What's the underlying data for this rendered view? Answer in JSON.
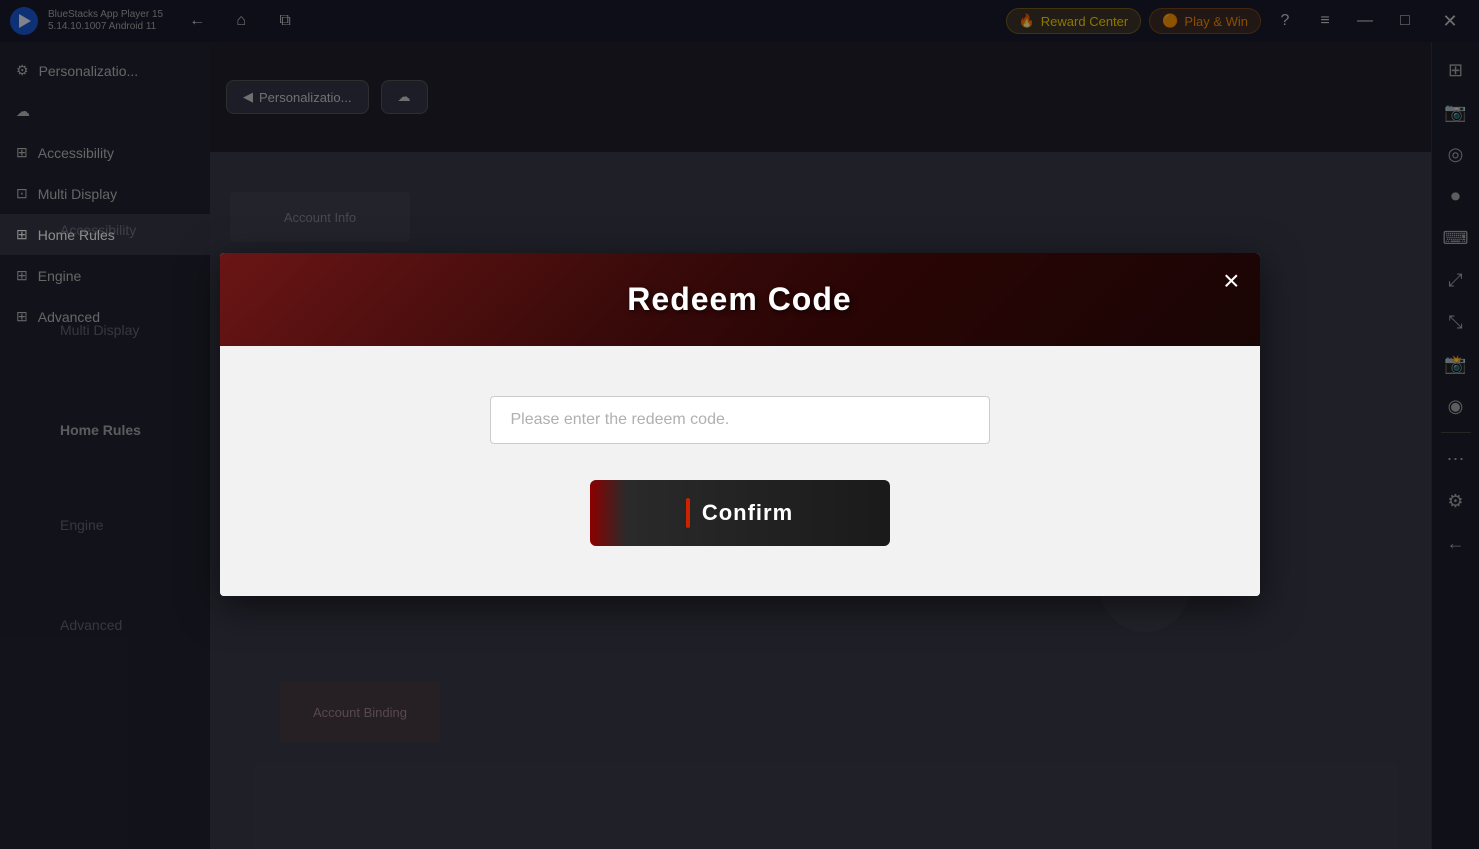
{
  "titleBar": {
    "appName": "BlueStacks App Player 15",
    "version": "5.14.10.1007  Android 11",
    "navBack": "←",
    "navHome": "⌂",
    "navLayers": "⧉",
    "rewardCenter": "Reward Center",
    "playWin": "Play & Win",
    "helpIcon": "?",
    "menuIcon": "≡",
    "minimizeIcon": "—",
    "maximizeIcon": "□",
    "closeIcon": "✕",
    "moreIcon": "⋯"
  },
  "sidebar": {
    "icons": [
      "⊞",
      "◎",
      "⏺",
      "⌨",
      "⤢",
      "⤡",
      "⊡",
      "⊙",
      "⊜",
      "⋯",
      "⚙",
      "←"
    ]
  },
  "gameSidebar": {
    "items": [
      {
        "label": "Personalizatio",
        "active": false
      },
      {
        "label": "",
        "active": false
      },
      {
        "label": "Accessibility",
        "active": false
      },
      {
        "label": "Multi Display",
        "active": false
      },
      {
        "label": "Home Rules",
        "active": true
      },
      {
        "label": "Engine",
        "active": false
      },
      {
        "label": "Advanced",
        "active": false
      }
    ]
  },
  "modal": {
    "title": "Redeem Code",
    "closeBtn": "×",
    "inputPlaceholder": "Please enter the redeem code.",
    "confirmBtn": "Confirm"
  }
}
